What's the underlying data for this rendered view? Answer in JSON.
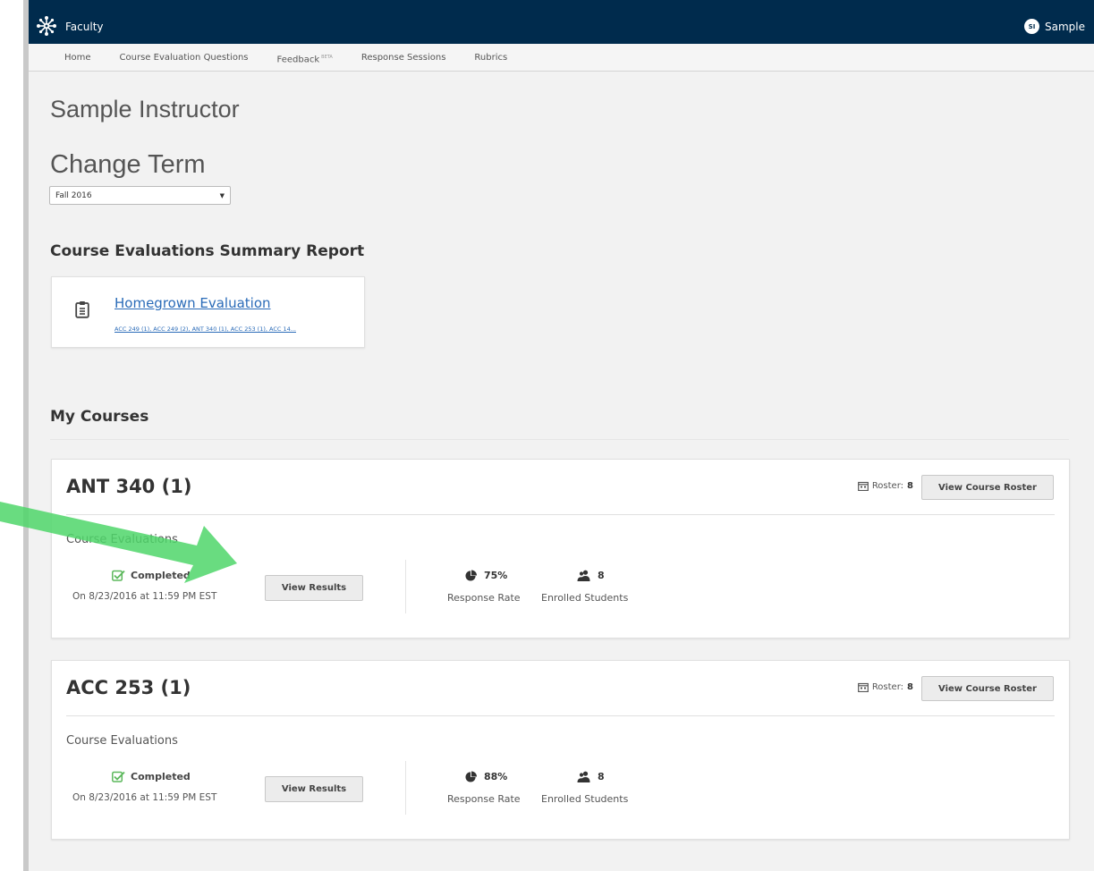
{
  "header": {
    "app_title": "Faculty",
    "user_initials": "SI",
    "user_name": "Sample"
  },
  "nav": {
    "items": [
      {
        "label": "Home"
      },
      {
        "label": "Course Evaluation Questions"
      },
      {
        "label": "Feedback",
        "badge": "BETA"
      },
      {
        "label": "Response Sessions"
      },
      {
        "label": "Rubrics"
      }
    ]
  },
  "page": {
    "title": "Sample Instructor",
    "term_heading": "Change Term",
    "term_selected": "Fall 2016"
  },
  "summary": {
    "heading": "Course Evaluations Summary Report",
    "link": "Homegrown Evaluation",
    "courses": "ACC 249 (1), ACC 249 (2), ANT 340 (1), ACC 253 (1), ACC 14..."
  },
  "courses_heading": "My Courses",
  "courses": [
    {
      "title": "ANT 340 (1)",
      "roster_label": "Roster:",
      "roster_count": "8",
      "roster_button": "View Course Roster",
      "eval_label": "Course Evaluations",
      "status": "Completed",
      "status_date": "On 8/23/2016 at 11:59 PM EST",
      "results_button": "View Results",
      "response_rate": "75%",
      "response_rate_label": "Response Rate",
      "enrolled": "8",
      "enrolled_label": "Enrolled Students"
    },
    {
      "title": "ACC 253 (1)",
      "roster_label": "Roster:",
      "roster_count": "8",
      "roster_button": "View Course Roster",
      "eval_label": "Course Evaluations",
      "status": "Completed",
      "status_date": "On 8/23/2016 at 11:59 PM EST",
      "results_button": "View Results",
      "response_rate": "88%",
      "response_rate_label": "Response Rate",
      "enrolled": "8",
      "enrolled_label": "Enrolled Students"
    }
  ],
  "colors": {
    "topbar": "#002b4d",
    "link": "#2a6bb8",
    "check": "#5cb85c",
    "arrow": "#4fd66a"
  }
}
